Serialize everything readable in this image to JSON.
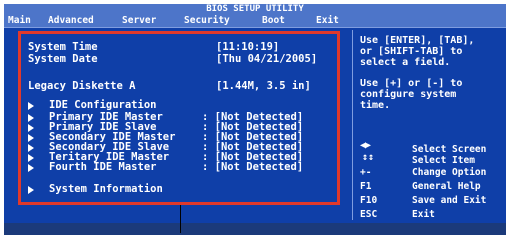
{
  "title": "BIOS SETUP UTILITY",
  "menu": [
    "Main",
    "Advanced",
    "Server",
    "Security",
    "Boot",
    "Exit"
  ],
  "main": {
    "system_time_label": "System Time",
    "system_time_value": "[11:10:19]",
    "system_date_label": "System Date",
    "system_date_value": "[Thu 04/21/2005]",
    "legacy_label": "Legacy Diskette A",
    "legacy_value": "[1.44M, 3.5 in]",
    "ide_config_label": "IDE Configuration",
    "ide_items": [
      {
        "label": "Primary IDE Master",
        "value": ": [Not Detected]"
      },
      {
        "label": "Primary IDE Slave",
        "value": ": [Not Detected]"
      },
      {
        "label": "Secondary IDE Master",
        "value": ": [Not Detected]"
      },
      {
        "label": "Secondary IDE Slave",
        "value": ": [Not Detected]"
      },
      {
        "label": "Teritary IDE Master",
        "value": ": [Not Detected]"
      },
      {
        "label": "Fourth IDE Master",
        "value": ": [Not Detected]"
      }
    ],
    "system_info_label": "System Information"
  },
  "help": {
    "line1": "Use [ENTER], [TAB],",
    "line2": "or [SHIFT-TAB] to",
    "line3": "select a field.",
    "line4": "Use [+] or [-] to",
    "line5": "configure system",
    "line6": "time."
  },
  "keys": [
    {
      "key": "",
      "desc": "Select Screen"
    },
    {
      "key": "",
      "desc": "Select Item"
    },
    {
      "key": "+-",
      "desc": "Change Option"
    },
    {
      "key": "F1",
      "desc": "General Help"
    },
    {
      "key": "F10",
      "desc": "Save and Exit"
    },
    {
      "key": "ESC",
      "desc": "Exit"
    }
  ],
  "colors": {
    "background": "#0f3fa8",
    "menubar": "#4d75c9",
    "highlight": "#e0392b"
  }
}
